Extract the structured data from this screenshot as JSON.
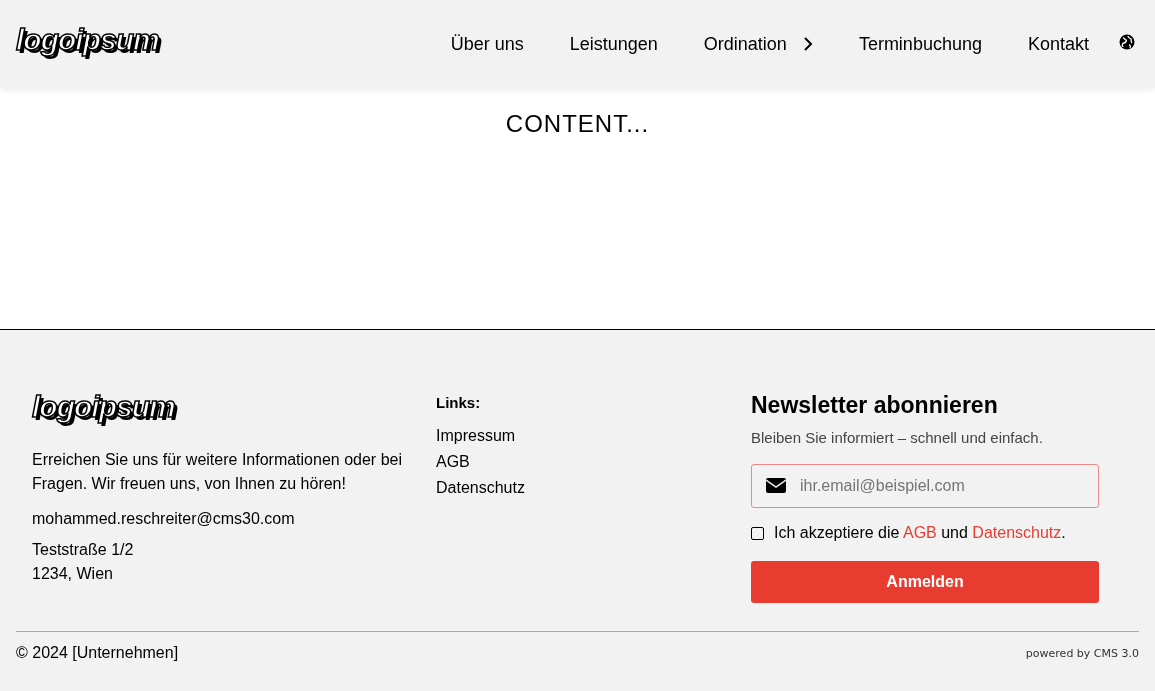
{
  "header": {
    "logo": "logoipsum",
    "nav": [
      {
        "label": "Über uns",
        "has_submenu": false
      },
      {
        "label": "Leistungen",
        "has_submenu": false
      },
      {
        "label": "Ordination",
        "has_submenu": true
      },
      {
        "label": "Terminbuchung",
        "has_submenu": false
      },
      {
        "label": "Kontakt",
        "has_submenu": false
      }
    ]
  },
  "content": {
    "text": "CONTENT..."
  },
  "footer": {
    "logo": "logoipsum",
    "about": "Erreichen Sie uns für weitere Informationen oder bei Fragen. Wir freuen uns, von Ihnen zu hören!",
    "email": "mohammed.reschreiter@cms30.com",
    "address": [
      "Teststraße 1/2",
      "1234, Wien"
    ],
    "links": {
      "title": "Links:",
      "items": [
        "Impressum",
        "AGB",
        "Datenschutz"
      ]
    },
    "newsletter": {
      "title": "Newsletter abonnieren",
      "subtitle": "Bleiben Sie informiert – schnell und einfach.",
      "placeholder": "ihr.email@beispiel.com",
      "consent": {
        "checked": false,
        "before": "Ich akzeptiere die",
        "link1": "AGB",
        "middle": "und",
        "link2": "Datenschutz",
        "after": "."
      },
      "button": "Anmelden"
    },
    "copyright": "© 2024 [Unternehmen]",
    "powered": "powered by CMS 3.0"
  }
}
